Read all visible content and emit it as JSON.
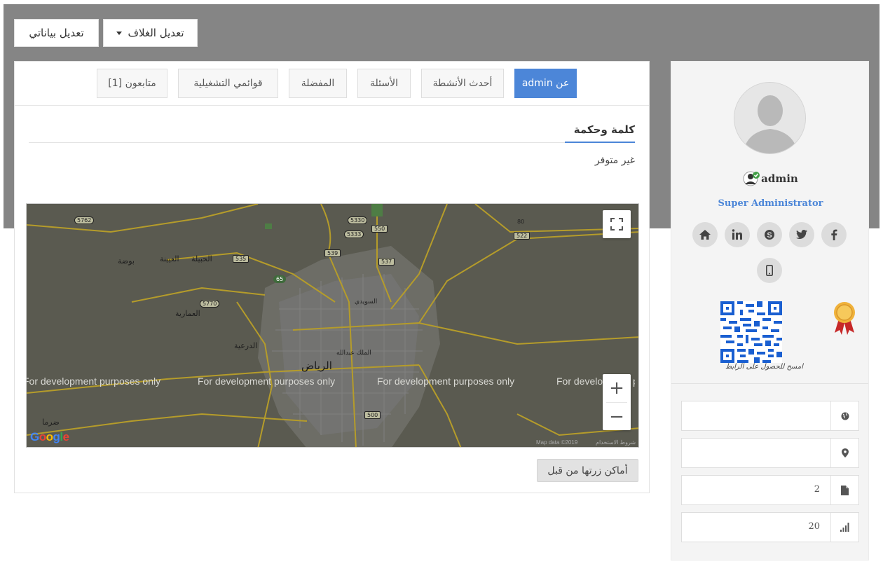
{
  "header": {
    "edit_data_label": "تعديل بياناتي",
    "edit_cover_label": "تعديل الغلاف"
  },
  "tabs": [
    {
      "label": "admin عن",
      "active": true
    },
    {
      "label": "أحدث الأنشطة",
      "active": false
    },
    {
      "label": "الأسئلة",
      "active": false
    },
    {
      "label": "المفضلة",
      "active": false
    },
    {
      "label": "قوائمي التشغيلية",
      "active": false
    },
    {
      "label": "متابعون [1]",
      "active": false
    }
  ],
  "about": {
    "section_title": "كلمة وحكمة",
    "value": "غير متوفر"
  },
  "map": {
    "watermark": "For development purposes only",
    "city_label": "الرياض",
    "places": [
      "بوضة",
      "العيينة",
      "الحبيلة",
      "العمارية",
      "الدرعية",
      "ضرما",
      "الملك عبدالله",
      "السويدي"
    ],
    "road_numbers": [
      "5762",
      "5330",
      "550",
      "5333",
      "539",
      "537",
      "535",
      "65",
      "5770",
      "80",
      "522",
      "500"
    ],
    "footer_data": "Map data ©2019",
    "footer_terms": "شروط الاستخدام",
    "google_logo_text": "Google",
    "zoom_in": "+",
    "zoom_out": "−"
  },
  "visited_places_label": "أماكن زرتها من قبل",
  "profile": {
    "username": "admin",
    "role": "Super Administrator",
    "social_icons": [
      "facebook-icon",
      "twitter-icon",
      "skype-icon",
      "linkedin-icon",
      "home-icon",
      "mobile-icon"
    ],
    "qr_caption": "امسح للحصول على الرابط",
    "stats": [
      {
        "icon": "globe-icon",
        "value": ""
      },
      {
        "icon": "map-pin-icon",
        "value": ""
      },
      {
        "icon": "file-icon",
        "value": "2"
      },
      {
        "icon": "bar-chart-icon",
        "value": "20"
      }
    ]
  },
  "colors": {
    "accent": "#4c86d8",
    "cover": "#858585",
    "map_background": "#5a5a50"
  }
}
